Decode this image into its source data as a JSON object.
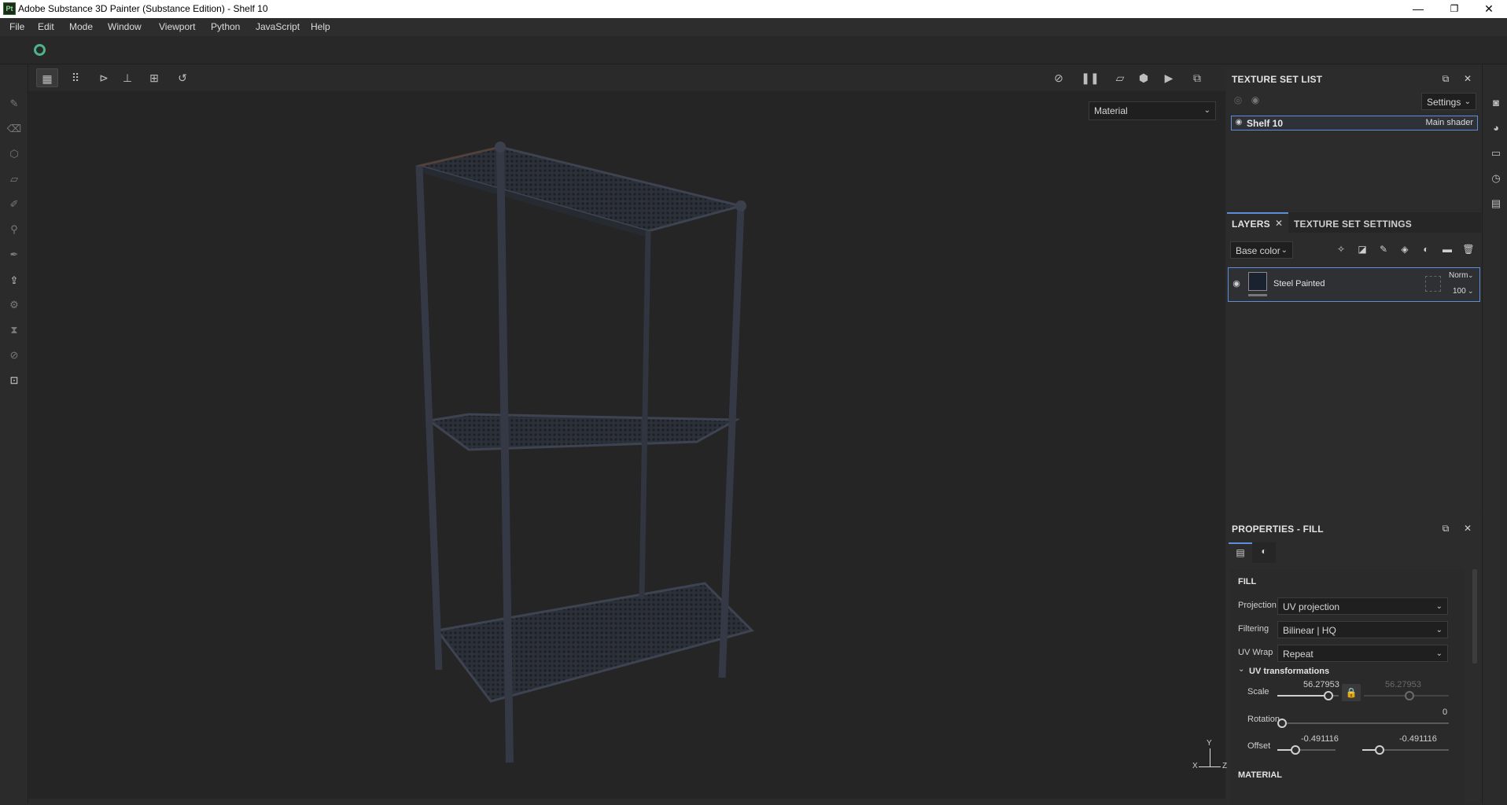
{
  "window": {
    "app_icon": "Pt",
    "title": "Adobe Substance 3D Painter (Substance Edition) - Shelf 10",
    "minimize": "—",
    "maximize": "❐",
    "close": "✕"
  },
  "menu": [
    "File",
    "Edit",
    "Mode",
    "Window",
    "Viewport",
    "Python",
    "JavaScript",
    "Help"
  ],
  "viewport": {
    "channel_dropdown": "Material",
    "axis": {
      "y": "Y",
      "x": "X",
      "z": "Z"
    }
  },
  "texture_set_list": {
    "title": "TEXTURE SET LIST",
    "settings_label": "Settings",
    "items": [
      {
        "name": "Shelf 10",
        "shader": "Main shader"
      }
    ]
  },
  "layers": {
    "tab_layers": "LAYERS",
    "tab_texture_set_settings": "TEXTURE SET SETTINGS",
    "channel": "Base color",
    "items": [
      {
        "name": "Steel Painted",
        "blend": "Norm",
        "opacity": "100"
      }
    ]
  },
  "properties": {
    "title": "PROPERTIES - FILL",
    "section_fill": "FILL",
    "projection_label": "Projection",
    "projection_value": "UV projection",
    "filtering_label": "Filtering",
    "filtering_value": "Bilinear | HQ",
    "uvwrap_label": "UV Wrap",
    "uvwrap_value": "Repeat",
    "uv_transformations": "UV transformations",
    "scale_label": "Scale",
    "scale_u": "56.27953",
    "scale_v": "56.27953",
    "rotation_label": "Rotation",
    "rotation_value": "0",
    "offset_label": "Offset",
    "offset_u": "-0.491116",
    "offset_v": "-0.491116",
    "next_section": "MATERIAL"
  }
}
